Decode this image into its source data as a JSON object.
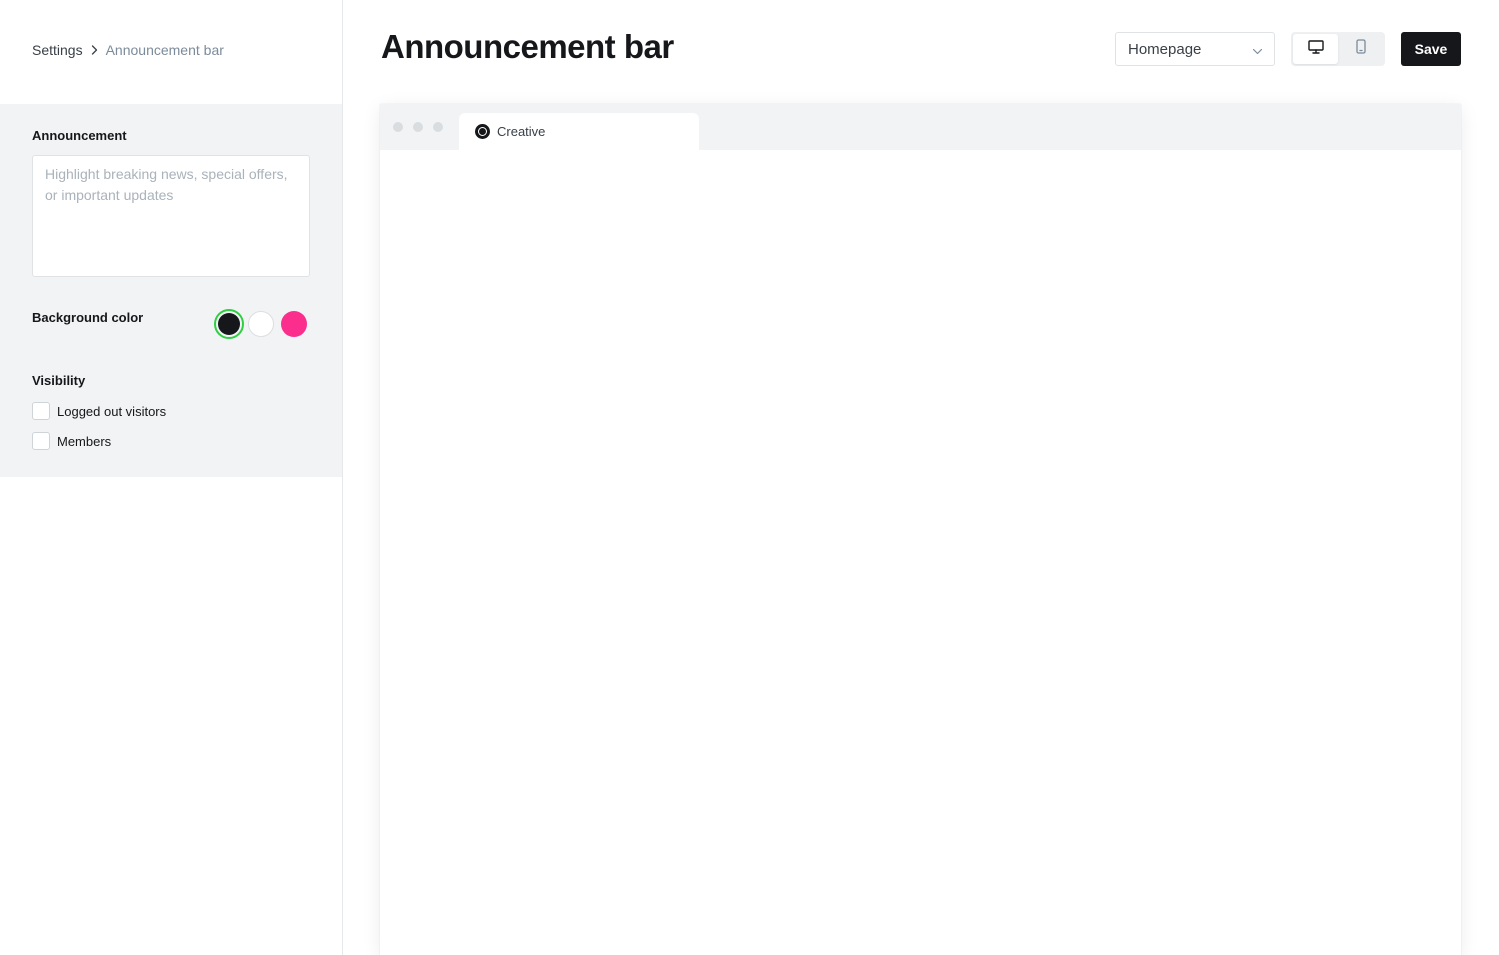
{
  "breadcrumb": {
    "parent": "Settings",
    "current": "Announcement bar"
  },
  "announcement": {
    "label": "Announcement",
    "value": "",
    "placeholder": "Highlight breaking news, special offers, or important updates"
  },
  "background_color": {
    "label": "Background color",
    "options": [
      {
        "name": "black",
        "color": "#15171a",
        "selected": true
      },
      {
        "name": "white",
        "color": "#ffffff",
        "selected": false
      },
      {
        "name": "pink",
        "color": "#fb2d8d",
        "selected": false
      }
    ],
    "selected_ring_color": "#30cf43"
  },
  "visibility": {
    "label": "Visibility",
    "options": [
      {
        "label": "Logged out visitors",
        "checked": false
      },
      {
        "label": "Members",
        "checked": false
      }
    ]
  },
  "header": {
    "title": "Announcement bar",
    "page_select_value": "Homepage",
    "device_options": [
      "desktop-icon",
      "mobile-icon"
    ],
    "active_device": "desktop",
    "save_label": "Save"
  },
  "preview": {
    "tab_title": "Creative"
  }
}
